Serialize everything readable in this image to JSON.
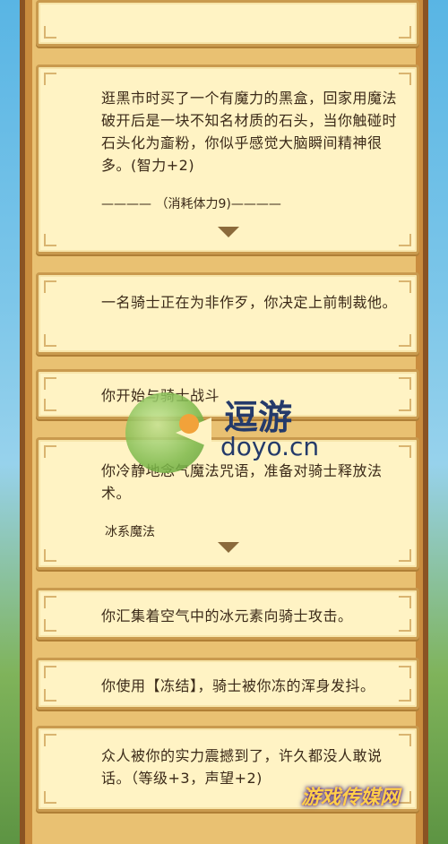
{
  "cards": [
    {
      "text": "逛黑市时买了一个有魔力的黑盒，回家用魔法破开后是一块不知名材质的石头，当你触碰时石头化为齑粉，你似乎感觉大脑瞬间精神很多。(智力+2)",
      "cost": "———— （消耗体力9)————"
    },
    {
      "text": "一名骑士正在为非作歹，你决定上前制裁他。"
    },
    {
      "text": "你开始与骑士战斗"
    },
    {
      "text": "你冷静地念气魔法咒语，准备对骑士释放法术。",
      "option": "冰系魔法"
    },
    {
      "text": "你汇集着空气中的冰元素向骑士攻击。"
    },
    {
      "text": "你使用【冻结】，骑士被你冻的浑身发抖。"
    },
    {
      "text": "众人被你的实力震撼到了，许久都没人敢说话。（等级+3，声望+2)"
    }
  ],
  "watermark": {
    "title": "逗游",
    "domain": "doyo.cn"
  },
  "brand": "游戏传媒网"
}
